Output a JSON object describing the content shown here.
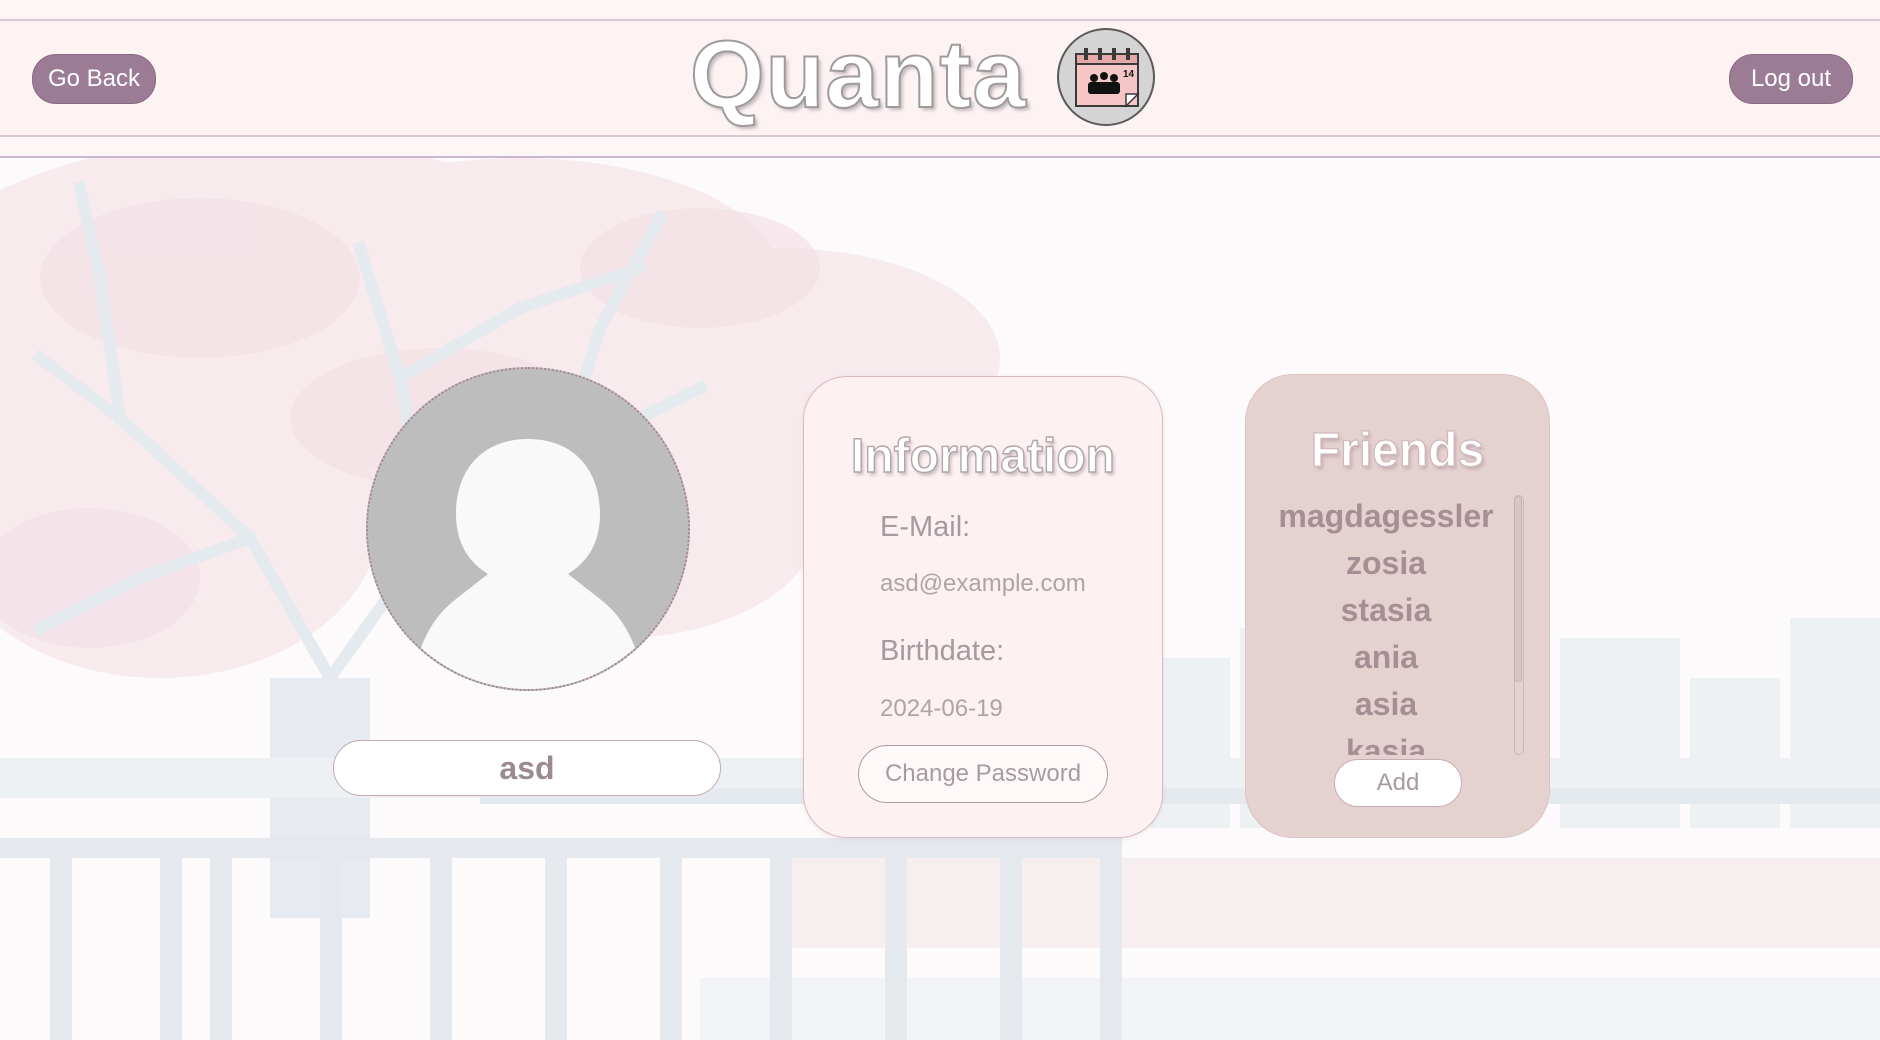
{
  "header": {
    "go_back_label": "Go Back",
    "logout_label": "Log out",
    "app_title": "Quanta",
    "logo_icon_badge": "14"
  },
  "profile": {
    "username": "asd"
  },
  "information": {
    "title": "Information",
    "email_label": "E-Mail:",
    "email_value": "asd@example.com",
    "birthdate_label": "Birthdate:",
    "birthdate_value": "2024-06-19",
    "change_password_label": "Change Password"
  },
  "friends": {
    "title": "Friends",
    "items": [
      "magdagessler",
      "zosia",
      "stasia",
      "ania",
      "asia",
      "kasia"
    ],
    "add_label": "Add"
  },
  "colors": {
    "accent": "#9c7b94",
    "header_bg": "#fdf3f3",
    "info_card_bg": "#fdf1f1",
    "friends_card_bg": "#e6d1d1"
  },
  "icons": [
    "calendar-group-icon",
    "default-avatar-icon"
  ]
}
